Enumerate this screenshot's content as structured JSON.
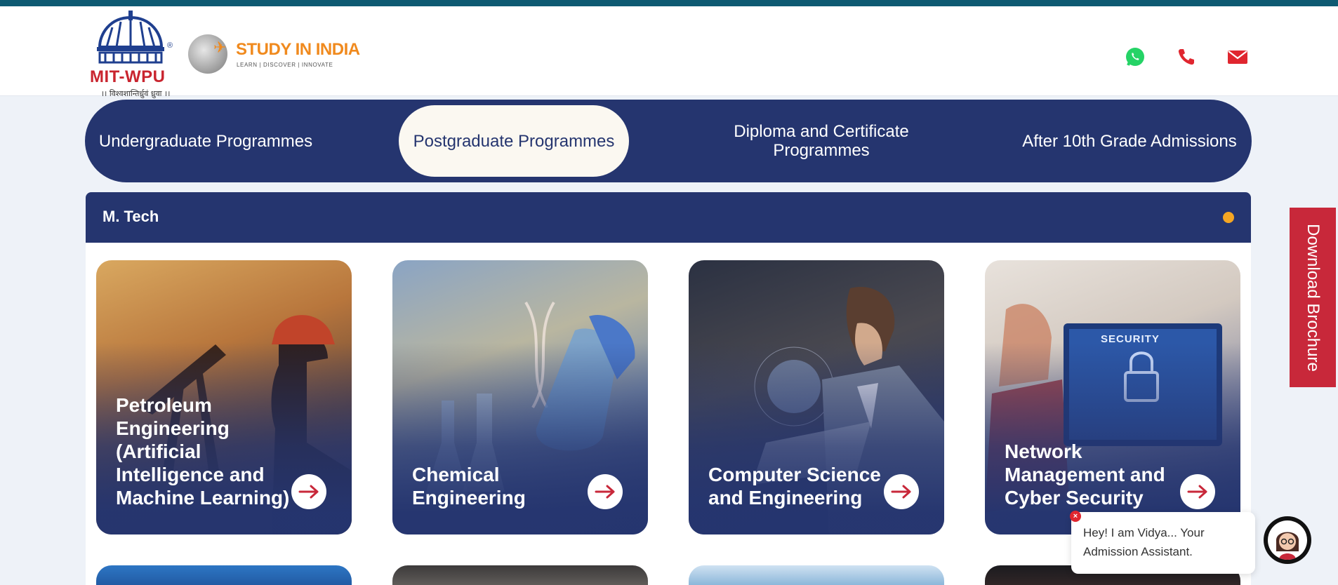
{
  "header": {
    "wpu_logo_text": "MIT-WPU",
    "wpu_logo_sub": "।। विश्वशान्तिर्ध्रुवं ध्रुवा ।।",
    "wpu_logo_reg": "®",
    "sii_logo_title": "STUDY IN INDIA",
    "sii_logo_tagline": "LEARN | DISCOVER | INNOVATE",
    "icons": [
      "whatsapp-icon",
      "phone-icon",
      "email-icon"
    ]
  },
  "tabs": [
    {
      "label": "Undergraduate Programmes",
      "active": false
    },
    {
      "label": "Postgraduate Programmes",
      "active": true
    },
    {
      "label": "Diploma and Certificate Programmes",
      "active": false
    },
    {
      "label": "After 10th Grade Admissions",
      "active": false
    }
  ],
  "accordion": {
    "title": "M. Tech"
  },
  "cards": [
    {
      "title": "Petroleum Engineering (Artificial Intelligence and Machine Learning)"
    },
    {
      "title": "Chemical Engineering"
    },
    {
      "title": "Computer Science and Engineering"
    },
    {
      "title": "Network Management and Cyber Security"
    }
  ],
  "brochure": {
    "label": "Download Brochure"
  },
  "chat": {
    "message": "Hey! I am Vidya... Your Admission Assistant.",
    "close": "×"
  },
  "colors": {
    "navy": "#25356f",
    "red": "#c8283a",
    "orange": "#f08a1e",
    "whatsapp": "#25d366",
    "teal_bar": "#0e5a72"
  }
}
